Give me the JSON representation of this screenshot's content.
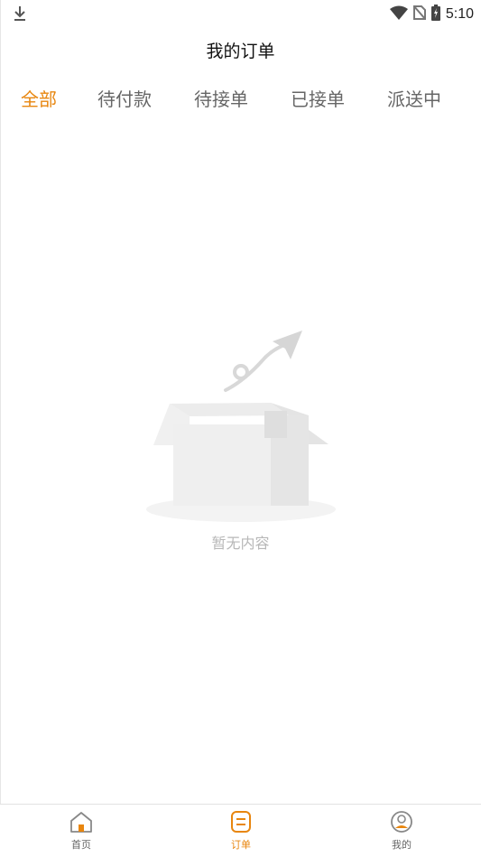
{
  "status_bar": {
    "time": "5:10",
    "icons": [
      "download-icon",
      "wifi-icon",
      "no-sim-icon",
      "battery-charging-icon"
    ]
  },
  "header": {
    "title": "我的订单"
  },
  "tabs": [
    {
      "label": "全部",
      "active": true
    },
    {
      "label": "待付款",
      "active": false
    },
    {
      "label": "待接单",
      "active": false
    },
    {
      "label": "已接单",
      "active": false
    },
    {
      "label": "派送中",
      "active": false
    }
  ],
  "empty_state": {
    "text": "暂无内容",
    "illustration": "empty-box-icon"
  },
  "bottom_nav": [
    {
      "label": "首页",
      "icon": "home-icon",
      "active": false
    },
    {
      "label": "订单",
      "icon": "order-icon",
      "active": true
    },
    {
      "label": "我的",
      "icon": "profile-icon",
      "active": false
    }
  ],
  "colors": {
    "accent": "#e8860f",
    "text": "#666666",
    "muted": "#b8b8b8"
  }
}
